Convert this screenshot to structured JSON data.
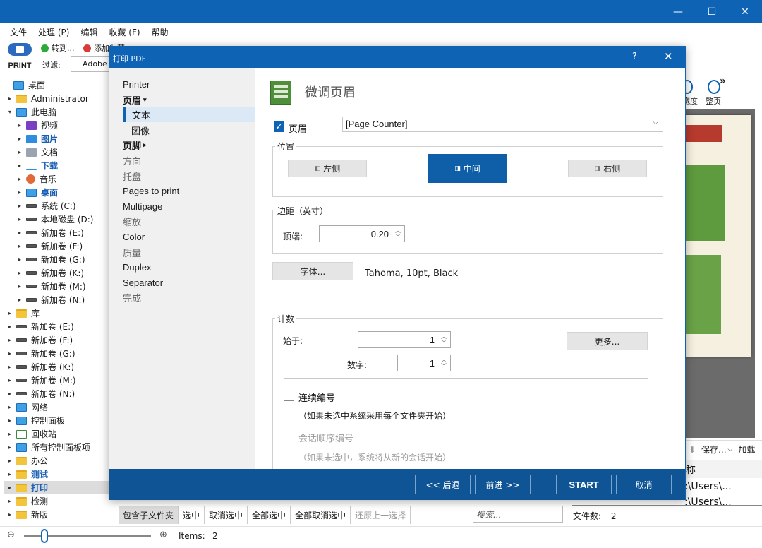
{
  "app": {
    "menu": [
      "文件",
      "处理 (P)",
      "编辑",
      "收藏 (F)",
      "帮助"
    ],
    "toolbar": {
      "print_label": "PRINT",
      "goto_label": "转到...",
      "add_fav_label": "添加收藏",
      "filter_label": "过滤:",
      "filter_value": "Adobe"
    },
    "tree": [
      {
        "label": "桌面",
        "icon": "desktop-icon",
        "level": 0,
        "arrow": ""
      },
      {
        "label": "Administrator",
        "icon": "folder-icon",
        "level": 1,
        "arrow": "▸"
      },
      {
        "label": "此电脑",
        "icon": "pc-icon",
        "level": 1,
        "arrow": "▾"
      },
      {
        "label": "视频",
        "icon": "video-icon",
        "level": 2,
        "arrow": "▸"
      },
      {
        "label": "图片",
        "icon": "pictures-icon",
        "level": 2,
        "arrow": "▸",
        "blue": true
      },
      {
        "label": "文档",
        "icon": "documents-icon",
        "level": 2,
        "arrow": "▸"
      },
      {
        "label": "下载",
        "icon": "download-icon",
        "level": 2,
        "arrow": "▸",
        "blue": true
      },
      {
        "label": "音乐",
        "icon": "music-icon",
        "level": 2,
        "arrow": "▸"
      },
      {
        "label": "桌面",
        "icon": "desktop-icon",
        "level": 2,
        "arrow": "▸",
        "blue": true
      },
      {
        "label": "系统 (C:)",
        "icon": "drive-icon",
        "level": 2,
        "arrow": "▸"
      },
      {
        "label": "本地磁盘 (D:)",
        "icon": "drive-icon",
        "level": 2,
        "arrow": "▸"
      },
      {
        "label": "新加卷 (E:)",
        "icon": "drive-icon",
        "level": 2,
        "arrow": "▸"
      },
      {
        "label": "新加卷 (F:)",
        "icon": "drive-icon",
        "level": 2,
        "arrow": "▸"
      },
      {
        "label": "新加卷 (G:)",
        "icon": "drive-icon",
        "level": 2,
        "arrow": "▸"
      },
      {
        "label": "新加卷 (K:)",
        "icon": "drive-icon",
        "level": 2,
        "arrow": "▸"
      },
      {
        "label": "新加卷 (M:)",
        "icon": "drive-icon",
        "level": 2,
        "arrow": "▸"
      },
      {
        "label": "新加卷 (N:)",
        "icon": "drive-icon",
        "level": 2,
        "arrow": "▸"
      },
      {
        "label": "库",
        "icon": "folder-icon",
        "level": 1,
        "arrow": "▸"
      },
      {
        "label": "新加卷 (E:)",
        "icon": "drive-icon",
        "level": 1,
        "arrow": "▸"
      },
      {
        "label": "新加卷 (F:)",
        "icon": "drive-icon",
        "level": 1,
        "arrow": "▸"
      },
      {
        "label": "新加卷 (G:)",
        "icon": "drive-icon",
        "level": 1,
        "arrow": "▸"
      },
      {
        "label": "新加卷 (K:)",
        "icon": "drive-icon",
        "level": 1,
        "arrow": "▸"
      },
      {
        "label": "新加卷 (M:)",
        "icon": "drive-icon",
        "level": 1,
        "arrow": "▸"
      },
      {
        "label": "新加卷 (N:)",
        "icon": "drive-icon",
        "level": 1,
        "arrow": "▸"
      },
      {
        "label": "网络",
        "icon": "network-icon",
        "level": 1,
        "arrow": "▸"
      },
      {
        "label": "控制面板",
        "icon": "control-panel-icon",
        "level": 1,
        "arrow": "▸"
      },
      {
        "label": "回收站",
        "icon": "recycle-bin-icon",
        "level": 1,
        "arrow": "▸"
      },
      {
        "label": "所有控制面板项",
        "icon": "control-panel-icon",
        "level": 1,
        "arrow": "▸"
      },
      {
        "label": "办公",
        "icon": "folder-icon",
        "level": 1,
        "arrow": "▸"
      },
      {
        "label": "测试",
        "icon": "folder-icon",
        "level": 1,
        "arrow": "▸",
        "bold": true
      },
      {
        "label": "打印",
        "icon": "folder-icon",
        "level": 1,
        "arrow": "▸",
        "bold": true,
        "selected": true
      },
      {
        "label": "检测",
        "icon": "folder-icon",
        "level": 1,
        "arrow": "▸"
      },
      {
        "label": "新版",
        "icon": "folder-icon",
        "level": 1,
        "arrow": "▸"
      }
    ],
    "bottom_toolbar": [
      "包含子文件夹",
      "选中",
      "取消选中",
      "全部选中",
      "全部取消选中",
      "还原上一选择"
    ],
    "search_placeholder": "搜索...",
    "status": {
      "items_label": "Items:",
      "items_value": "2",
      "file_count_label": "文件数:",
      "file_count_value": "2"
    },
    "right_panel": {
      "width_label": "宽度",
      "fullpage_label": "整页",
      "save_label": "保存...",
      "add_label": "加载",
      "name_header": "称",
      "path1": ":\\Users\\...",
      "path2": ":\\Users\\..."
    }
  },
  "dialog": {
    "title": "打印 PDF",
    "help": "?",
    "nav": [
      {
        "label": "Printer",
        "style": "normal"
      },
      {
        "label": "页眉",
        "style": "bold",
        "arrow": "▾"
      },
      {
        "label": "文本",
        "style": "active"
      },
      {
        "label": "图像",
        "style": "sub"
      },
      {
        "label": "页脚",
        "style": "bold",
        "arrow": "▸"
      },
      {
        "label": "方向",
        "style": "muted"
      },
      {
        "label": "托盘",
        "style": "muted"
      },
      {
        "label": "Pages to print",
        "style": "normal"
      },
      {
        "label": "Multipage",
        "style": "normal"
      },
      {
        "label": "缩放",
        "style": "muted"
      },
      {
        "label": "Color",
        "style": "normal"
      },
      {
        "label": "质量",
        "style": "muted"
      },
      {
        "label": "Duplex",
        "style": "normal"
      },
      {
        "label": "Separator",
        "style": "normal"
      },
      {
        "label": "完成",
        "style": "muted"
      }
    ],
    "heading": "微调页眉",
    "header_checkbox_label": "页眉",
    "header_checked": true,
    "header_select_value": "[Page Counter]",
    "position": {
      "group_label": "位置",
      "left": "左侧",
      "center": "中间",
      "right": "右侧",
      "selected": "center"
    },
    "margin": {
      "group_label": "边距（英寸）",
      "top_label": "顶端:",
      "top_value": "0.20"
    },
    "font": {
      "button_label": "字体...",
      "value": "Tahoma, 10pt, Black"
    },
    "counter": {
      "group_label": "计数",
      "start_label": "始于:",
      "start_value": "1",
      "digits_label": "数字:",
      "digits_value": "1",
      "more_label": "更多...",
      "continuous_label": "连续编号",
      "continuous_checked": false,
      "continuous_note": "（如果未选中系统采用每个文件夹开始）",
      "session_label": "会话顺序编号",
      "session_checked": false,
      "session_note": "（如果未选中，系统将从新的会话开始）"
    },
    "footer": {
      "back": "<< 后退",
      "next": "前进 >>",
      "start": "START",
      "cancel": "取消"
    }
  },
  "colors": {
    "accent": "#0f63b4",
    "footer": "#0f5494",
    "selected_nav": "#dbe8f6"
  }
}
